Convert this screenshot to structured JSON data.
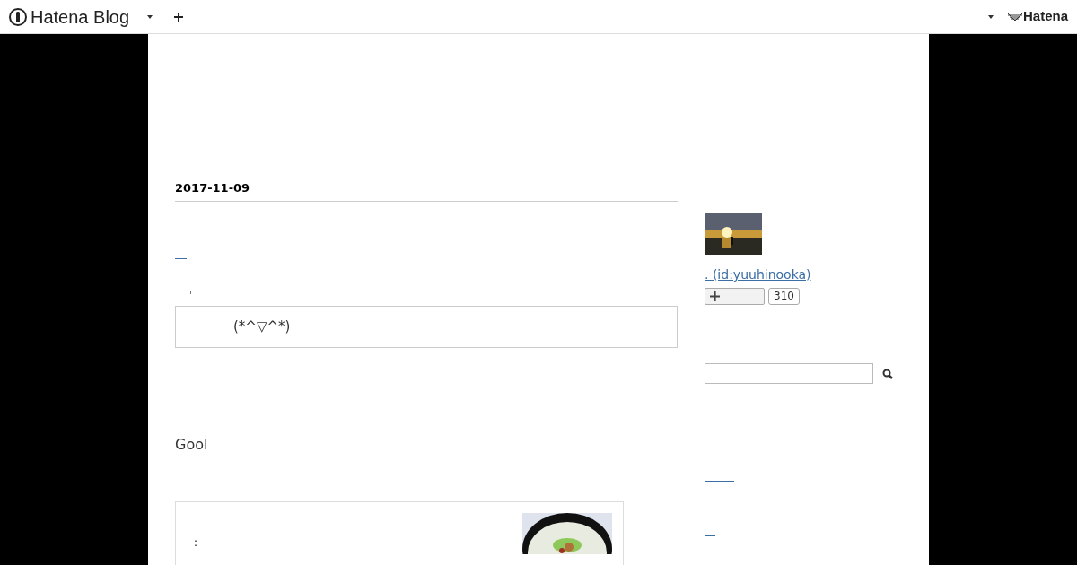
{
  "header": {
    "logo": "Hatena Blog",
    "brand": "Hatena"
  },
  "entry": {
    "date": "2017-11-09",
    "comma": "ˌ",
    "quote": "(*^▽^*)",
    "heading": "Gool",
    "card_text": ":"
  },
  "profile": {
    "id_link": ". (id:yuuhinooka)",
    "subscriber_count": "310"
  }
}
